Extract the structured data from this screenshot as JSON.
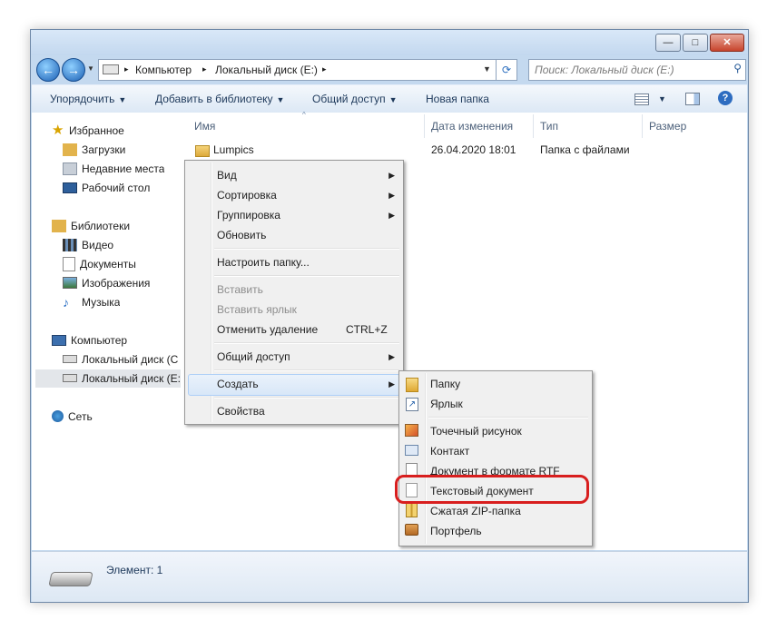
{
  "window": {
    "caption_buttons": {
      "minimize": "—",
      "maximize": "□",
      "close": "✕"
    }
  },
  "navbar": {
    "back_icon": "back-arrow-icon",
    "forward_icon": "forward-arrow-icon",
    "breadcrumb": [
      "Компьютер",
      "Локальный диск (E:)"
    ],
    "breadcrumb_sep": "▸",
    "search_placeholder": "Поиск: Локальный диск (E:)"
  },
  "toolbar": {
    "organize": "Упорядочить",
    "add_to_library": "Добавить в библиотеку",
    "share": "Общий доступ",
    "new_folder": "Новая папка",
    "dropdown_arrow": "▼"
  },
  "sidebar": {
    "favorites": {
      "title": "Избранное",
      "items": [
        "Загрузки",
        "Недавние места",
        "Рабочий стол"
      ]
    },
    "libraries": {
      "title": "Библиотеки",
      "items": [
        "Видео",
        "Документы",
        "Изображения",
        "Музыка"
      ]
    },
    "computer": {
      "title": "Компьютер",
      "items": [
        "Локальный диск (C",
        "Локальный диск (E:"
      ]
    },
    "network": {
      "title": "Сеть"
    }
  },
  "columns": [
    "Имя",
    "Дата изменения",
    "Тип",
    "Размер"
  ],
  "files": [
    {
      "name": "Lumpics",
      "date": "26.04.2020 18:01",
      "type": "Папка с файлами",
      "size": ""
    }
  ],
  "context_menu": {
    "items": [
      {
        "label": "Вид",
        "submenu": true
      },
      {
        "label": "Сортировка",
        "submenu": true
      },
      {
        "label": "Группировка",
        "submenu": true
      },
      {
        "label": "Обновить"
      },
      {
        "label": "Настроить папку..."
      },
      {
        "label": "Вставить",
        "disabled": true
      },
      {
        "label": "Вставить ярлык",
        "disabled": true
      },
      {
        "label": "Отменить удаление",
        "shortcut": "CTRL+Z"
      },
      {
        "label": "Общий доступ",
        "submenu": true
      },
      {
        "label": "Создать",
        "submenu": true,
        "hovered": true
      },
      {
        "label": "Свойства"
      }
    ],
    "submenu_arrow": "▶"
  },
  "create_submenu": {
    "items": [
      {
        "label": "Папку",
        "icon": "folder-icon"
      },
      {
        "label": "Ярлык",
        "icon": "shortcut-icon"
      },
      {
        "label": "Точечный рисунок",
        "icon": "bitmap-icon"
      },
      {
        "label": "Контакт",
        "icon": "contact-icon"
      },
      {
        "label": "Документ в формате RTF",
        "icon": "rtf-document-icon"
      },
      {
        "label": "Текстовый документ",
        "icon": "text-document-icon",
        "highlighted": true
      },
      {
        "label": "Сжатая ZIP-папка",
        "icon": "zip-folder-icon"
      },
      {
        "label": "Портфель",
        "icon": "briefcase-icon"
      }
    ],
    "highlight_color": "#d81e1e"
  },
  "status": {
    "text": "Элемент: 1"
  }
}
